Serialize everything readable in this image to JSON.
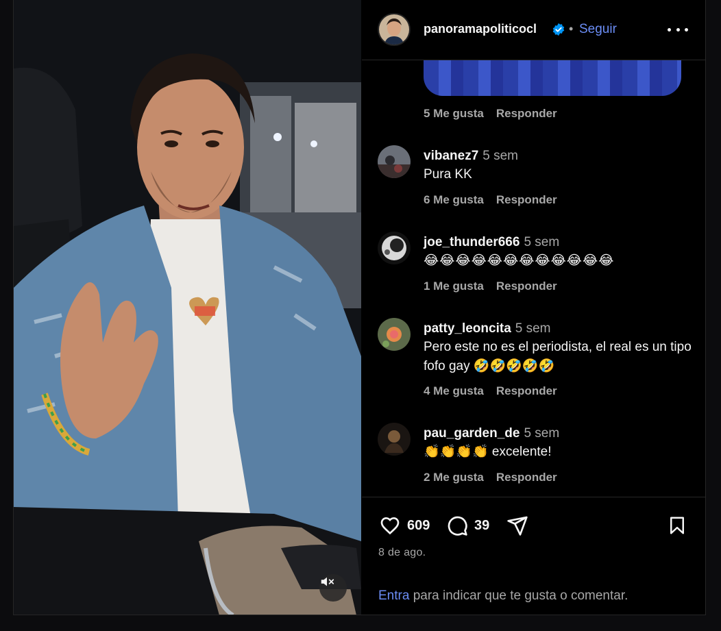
{
  "post": {
    "username": "panoramapoliticocl",
    "verified": true,
    "separator": "•",
    "follow_label": "Seguir",
    "more_icon": "more-horizontal-icon"
  },
  "previous_comment": {
    "likes": "5 Me gusta",
    "reply_label": "Responder"
  },
  "comments": [
    {
      "username": "vibanez7",
      "time": "5 sem",
      "text": "Pura KK",
      "likes": "6 Me gusta",
      "reply_label": "Responder"
    },
    {
      "username": "joe_thunder666",
      "time": "5 sem",
      "text": "😂😂😂😂😂😂😂😂😂😂😂😂",
      "likes": "1 Me gusta",
      "reply_label": "Responder"
    },
    {
      "username": "patty_leoncita",
      "time": "5 sem",
      "text": "Pero este no es el periodista, el real es un tipo fofo gay 🤣🤣🤣🤣🤣",
      "likes": "4 Me gusta",
      "reply_label": "Responder"
    },
    {
      "username": "pau_garden_de",
      "time": "5 sem",
      "text": "👏👏👏👏 excelente!",
      "likes": "2 Me gusta",
      "reply_label": "Responder"
    }
  ],
  "actions": {
    "likes_count": "609",
    "comments_count": "39",
    "like_icon": "heart-icon",
    "comment_icon": "comment-bubble-icon",
    "share_icon": "send-icon",
    "save_icon": "bookmark-icon"
  },
  "date": "8 de ago.",
  "login_prompt": {
    "link_text": "Entra",
    "rest_text": " para indicar que te gusta o comentar."
  },
  "media": {
    "mute_icon": "speaker-muted-icon"
  },
  "colors": {
    "accent_link": "#6b8df5",
    "verified_badge": "#0095f6",
    "muted_text": "#a8a8a8",
    "background": "#000000"
  }
}
